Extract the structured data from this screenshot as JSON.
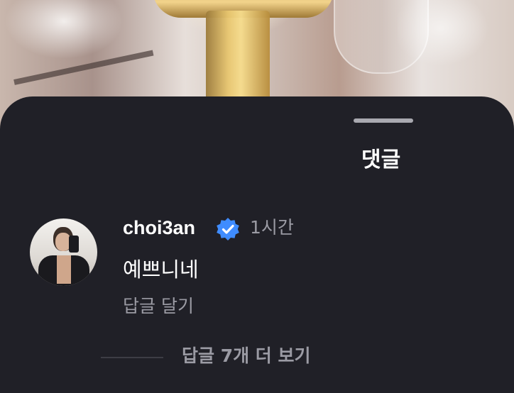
{
  "sheet": {
    "title": "댓글"
  },
  "comment": {
    "username": "choi3an",
    "verified": true,
    "verified_icon": "verified-badge-icon",
    "time_ago": "1시간",
    "text": "예쁘니네",
    "reply_label": "답글 달기",
    "view_replies_label": "답글 7개 더 보기"
  },
  "colors": {
    "sheet_background": "#202027",
    "primary_text": "#ffffff",
    "secondary_text": "#9b9ba4",
    "verified_blue": "#3f8cff"
  }
}
